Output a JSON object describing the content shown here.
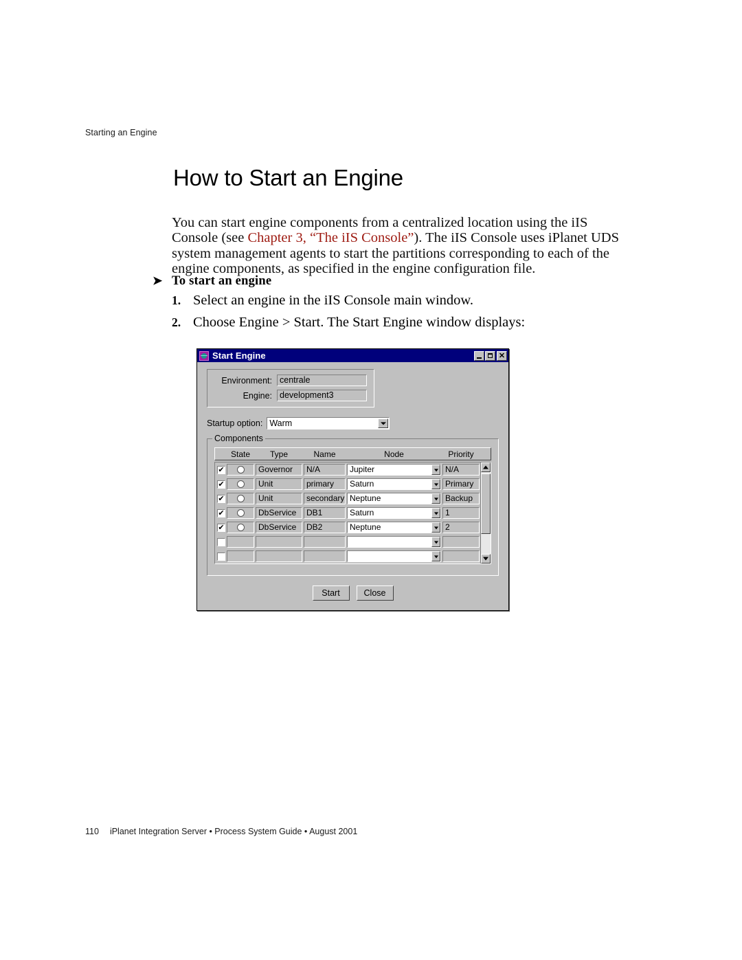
{
  "running_header": "Starting an Engine",
  "page_title": "How to Start an Engine",
  "intro": {
    "part1": "You can start engine components from a centralized location using the iIS Console (see ",
    "xref": "Chapter 3, “The iIS Console”",
    "part2": "). The iIS Console uses iPlanet UDS system management agents to start the partitions corresponding to each of the engine components, as specified in the engine configuration file."
  },
  "procedure": {
    "arrow": "➤",
    "heading": "To start an engine",
    "steps": [
      {
        "num": "1.",
        "text": "Select an engine in the iIS Console main window."
      },
      {
        "num": "2.",
        "text": "Choose Engine > Start. The Start Engine window displays:"
      }
    ]
  },
  "dialog": {
    "title": "Start Engine",
    "icon": "app-globe-icon",
    "window_buttons": [
      {
        "name": "minimize",
        "glyph": "_"
      },
      {
        "name": "maximize",
        "glyph": "□"
      },
      {
        "name": "close",
        "glyph": "✕"
      }
    ],
    "fields": [
      {
        "label": "Environment:",
        "value": "centrale"
      },
      {
        "label": "Engine:",
        "value": "development3"
      }
    ],
    "startup": {
      "label": "Startup option:",
      "value": "Warm"
    },
    "components": {
      "legend": "Components",
      "columns": [
        "State",
        "Type",
        "Name",
        "Node",
        "Priority"
      ],
      "rows": [
        {
          "checked": true,
          "state": "off",
          "type": "Governor",
          "name": "N/A",
          "node": "Jupiter",
          "priority": "N/A"
        },
        {
          "checked": true,
          "state": "off",
          "type": "Unit",
          "name": "primary",
          "node": "Saturn",
          "priority": "Primary"
        },
        {
          "checked": true,
          "state": "off",
          "type": "Unit",
          "name": "secondary",
          "node": "Neptune",
          "priority": "Backup"
        },
        {
          "checked": true,
          "state": "off",
          "type": "DbService",
          "name": "DB1",
          "node": "Saturn",
          "priority": "1"
        },
        {
          "checked": true,
          "state": "off",
          "type": "DbService",
          "name": "DB2",
          "node": "Neptune",
          "priority": "2"
        },
        {
          "checked": false,
          "state": "",
          "type": "",
          "name": "",
          "node": "",
          "priority": ""
        },
        {
          "checked": false,
          "state": "",
          "type": "",
          "name": "",
          "node": "",
          "priority": ""
        }
      ],
      "checkmark": "✔"
    },
    "buttons": [
      {
        "name": "start",
        "label": "Start"
      },
      {
        "name": "close",
        "label": "Close"
      }
    ]
  },
  "footer": {
    "page_number": "110",
    "text": "iPlanet Integration Server • Process System Guide • August 2001"
  },
  "colors": {
    "titlebar": "#00007b",
    "dialog_face": "#c0c0c0",
    "xref_red": "#9e1b12"
  }
}
